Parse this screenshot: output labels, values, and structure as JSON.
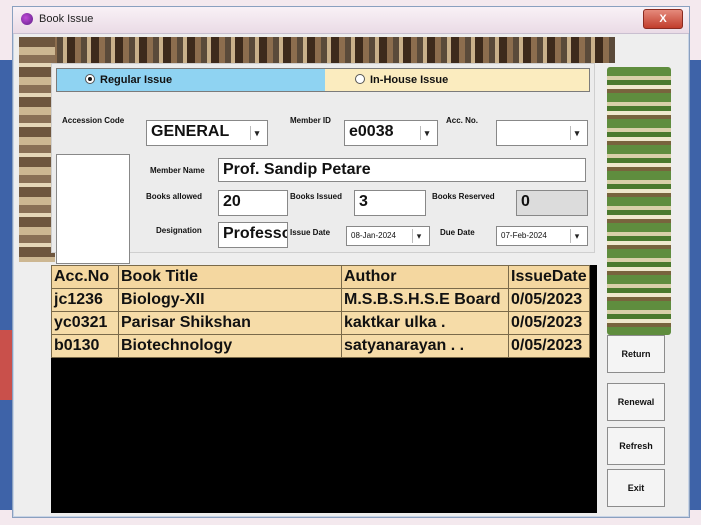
{
  "window": {
    "title": "Book Issue",
    "close_label": "X"
  },
  "radio": {
    "regular_label": "Regular Issue",
    "inhouse_label": "In-House Issue"
  },
  "form": {
    "accession_code_label": "Accession Code",
    "accession_code_value": "GENERAL",
    "member_id_label": "Member ID",
    "member_id_value": "e0038",
    "acc_no_label": "Acc. No.",
    "acc_no_value": "",
    "member_name_label": "Member Name",
    "member_name_value": "Prof. Sandip Petare",
    "books_allowed_label": "Books allowed",
    "books_allowed_value": "20",
    "books_issued_label": "Books Issued",
    "books_issued_value": "3",
    "books_reserved_label": "Books Reserved",
    "books_reserved_value": "0",
    "designation_label": "Designation",
    "designation_value": "Professor",
    "issue_date_label": "Issue Date",
    "issue_date_value": "08-Jan-2024",
    "due_date_label": "Due Date",
    "due_date_value": "07-Feb-2024"
  },
  "table": {
    "columns": [
      "Acc.No",
      "Book Title",
      "Author",
      "IssueDate"
    ],
    "rows": [
      [
        "jc1236",
        "Biology-XII",
        "M.S.B.S.H.S.E Board",
        "0/05/2023"
      ],
      [
        "yc0321",
        "Parisar Shikshan",
        "kaktkar ulka .",
        "0/05/2023"
      ],
      [
        "b0130",
        "Biotechnology",
        "satyanarayan . .",
        "0/05/2023"
      ]
    ]
  },
  "buttons": {
    "return": "Return",
    "renewal": "Renewal",
    "refresh": "Refresh",
    "exit": "Exit"
  },
  "icons": {
    "title": "book-app-icon",
    "dropdown": "chevron-down-icon"
  }
}
